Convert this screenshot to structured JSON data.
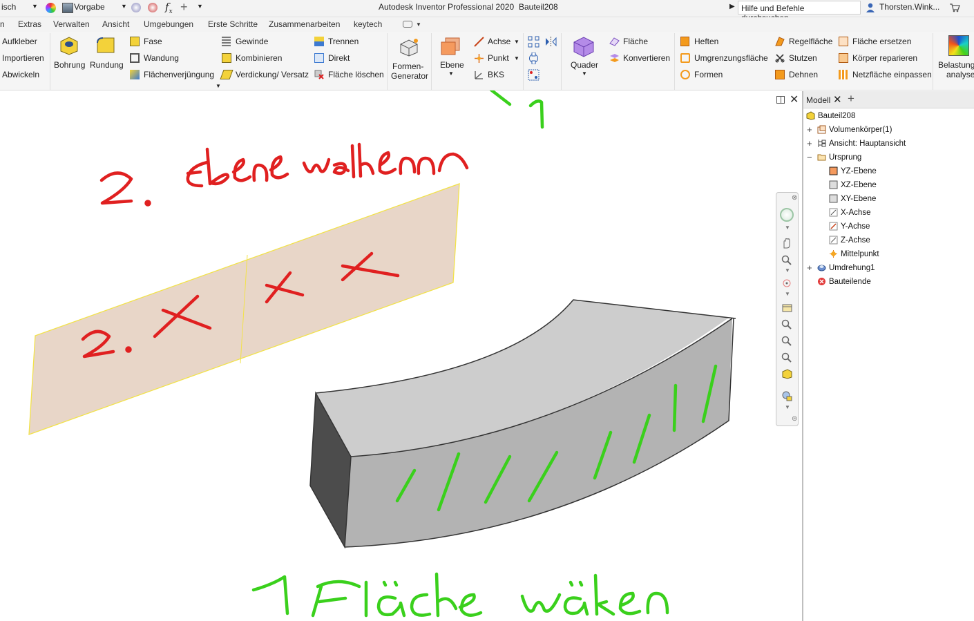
{
  "topbar": {
    "language_fragment": "isch",
    "appearance_label": "Vorgabe",
    "fx_symbol": "f",
    "fx_subscript": "x",
    "title": "Autodesk Inventor Professional 2020",
    "document": "Bauteil208",
    "search_placeholder": "Hilfe und Befehle durchsuchen...",
    "user": "Thorsten.Wink..."
  },
  "menu": {
    "items": [
      "n",
      "Extras",
      "Verwalten",
      "Ansicht",
      "Umgebungen",
      "Erste Schritte",
      "Zusammenarbeiten",
      "keytech"
    ]
  },
  "ribbon": {
    "left_col": [
      "Aufkleber",
      "Importieren",
      "Abwickeln"
    ],
    "bohrung": "Bohrung",
    "rundung": "Rundung",
    "modify_col1": [
      "Fase",
      "Wandung",
      "Flächenverjüngung"
    ],
    "modify_col2": [
      "Gewinde",
      "Kombinieren",
      "Verdickung/ Versatz"
    ],
    "modify_col3": [
      "Trennen",
      "Direkt",
      "Fläche löschen"
    ],
    "formen_generator": [
      "Formen-",
      "Generator"
    ],
    "ebene": "Ebene",
    "work_features": [
      "Achse",
      "Punkt",
      "BKS"
    ],
    "quader": "Quader",
    "surface_col1": [
      "Fläche",
      "Konvertieren"
    ],
    "surface_col2": [
      "Heften",
      "Umgrenzungsfläche",
      "Formen"
    ],
    "surface_col3": [
      "Regelfläche",
      "Stutzen",
      "Dehnen"
    ],
    "surface_col4": [
      "Fläche ersetzen",
      "Körper reparieren",
      "Netzfläche einpassen"
    ],
    "belastung": [
      "Belastung",
      "analyse"
    ]
  },
  "browser": {
    "tab": "Modell",
    "tree": [
      {
        "label": "Bauteil208",
        "level": 0,
        "expander": ""
      },
      {
        "label": "Volumenkörper(1)",
        "level": 1,
        "expander": "+"
      },
      {
        "label": "Ansicht: Hauptansicht",
        "level": 1,
        "expander": "+"
      },
      {
        "label": "Ursprung",
        "level": 1,
        "expander": "−"
      },
      {
        "label": "YZ-Ebene",
        "level": 2,
        "expander": ""
      },
      {
        "label": "XZ-Ebene",
        "level": 2,
        "expander": ""
      },
      {
        "label": "XY-Ebene",
        "level": 2,
        "expander": ""
      },
      {
        "label": "X-Achse",
        "level": 2,
        "expander": ""
      },
      {
        "label": "Y-Achse",
        "level": 2,
        "expander": ""
      },
      {
        "label": "Z-Achse",
        "level": 2,
        "expander": ""
      },
      {
        "label": "Mittelpunkt",
        "level": 2,
        "expander": ""
      },
      {
        "label": "Umdrehung1",
        "level": 1,
        "expander": "+"
      },
      {
        "label": "Bauteilende",
        "level": 1,
        "expander": ""
      }
    ]
  },
  "annotations": {
    "red_title": "2. Ebene wählen",
    "red_plane_note": "2. X X X",
    "green_marker": "1",
    "green_bottom": "1 Fläche wählen"
  },
  "colors": {
    "ribbon_bg": "#f5f5f5",
    "plane_fill": "#e8d6c8",
    "plane_edge": "#f2e24a",
    "solid_top": "#cdcdcd",
    "solid_front": "#b3b3b3",
    "solid_side": "#4c4c4c",
    "annotation_red": "#e02020",
    "annotation_green": "#3ad01c"
  }
}
